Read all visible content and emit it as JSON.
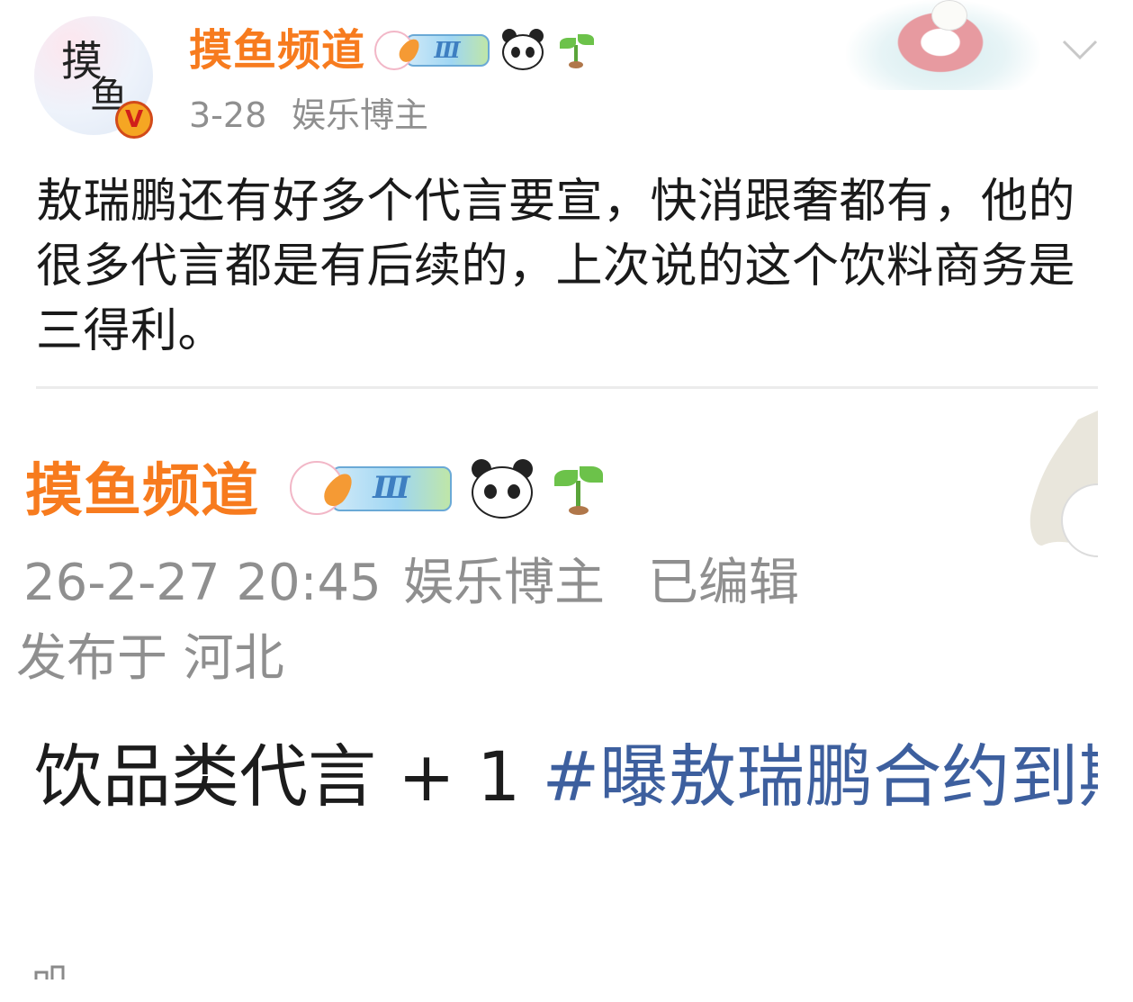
{
  "post": {
    "username": "摸鱼频道",
    "date": "3-28",
    "category": "娱乐博主",
    "level_badge": "Ⅲ",
    "verified_mark": "V",
    "avatar_text": [
      "摸",
      "鱼"
    ],
    "text": "敖瑞鹏还有好多个代言要宣，快消跟奢都有，他的很多代言都是有后续的，上次说的这个饮料商务是三得利。"
  },
  "quoted_screenshot": {
    "username": "摸鱼频道",
    "level_badge": "Ⅲ",
    "timestamp": "26-2-27 20:45",
    "category": "娱乐博主",
    "edited": "已编辑",
    "location": "发布于 河北",
    "text_plain": "饮品类代言 + 1 ",
    "hashtag": "#曝敖瑞鹏合约到期"
  },
  "icons": [
    "verified-v-icon",
    "rabbit-level-badge-icon",
    "panda-icon",
    "sprout-icon",
    "chevron-down-icon",
    "bear-float-decoration"
  ],
  "colors": {
    "username": "#f77b1e",
    "meta": "#8f8f8f",
    "hashtag": "#3d5f9e",
    "text": "#1a1a1a"
  }
}
